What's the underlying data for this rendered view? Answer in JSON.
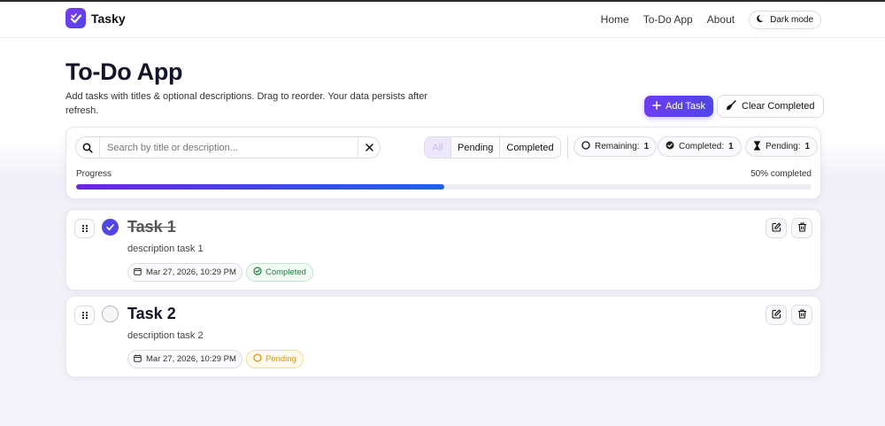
{
  "nav": {
    "brand": "Tasky",
    "links": [
      "Home",
      "To-Do App",
      "About"
    ],
    "dark_mode_label": "Dark mode"
  },
  "header": {
    "title": "To-Do App",
    "subtitle": "Add tasks with titles & optional descriptions. Drag to reorder. Your data persists after refresh.",
    "add_task_label": "Add Task",
    "clear_completed_label": "Clear Completed"
  },
  "toolbar": {
    "search_placeholder": "Search by title or description...",
    "search_value": "",
    "filters": [
      "All",
      "Pending",
      "Completed"
    ],
    "active_filter": "All",
    "stats": {
      "remaining_label": "Remaining:",
      "remaining_value": "1",
      "completed_label": "Completed:",
      "completed_value": "1",
      "pending_label": "Pending:",
      "pending_value": "1"
    },
    "progress_label": "Progress",
    "progress_text": "50% completed",
    "progress_fraction": 0.5
  },
  "tasks": [
    {
      "title": "Task 1",
      "description": "description task 1",
      "date": "Mar 27, 2026, 10:29 PM",
      "status": "Completed",
      "done": true
    },
    {
      "title": "Task 2",
      "description": "description task 2",
      "date": "Mar 27, 2026, 10:29 PM",
      "status": "Pending",
      "done": false
    }
  ],
  "colors": {
    "accent": "#4f46e5",
    "accent_gradient_start": "#6d28d9",
    "progress_end": "#1d64e0",
    "completed_green": "#1e7d3e",
    "pending_amber": "#d99a06"
  },
  "icons": {
    "brand": "check-badge-icon",
    "dark_mode": "moon-icon",
    "add": "plus-icon",
    "clear": "broom-icon",
    "search": "search-icon",
    "clear_search": "close-icon",
    "remaining": "circle-icon",
    "completed": "check-circle-icon",
    "pending": "hourglass-icon",
    "drag": "grip-icon",
    "calendar": "calendar-icon",
    "edit": "edit-icon",
    "delete": "trash-icon"
  }
}
